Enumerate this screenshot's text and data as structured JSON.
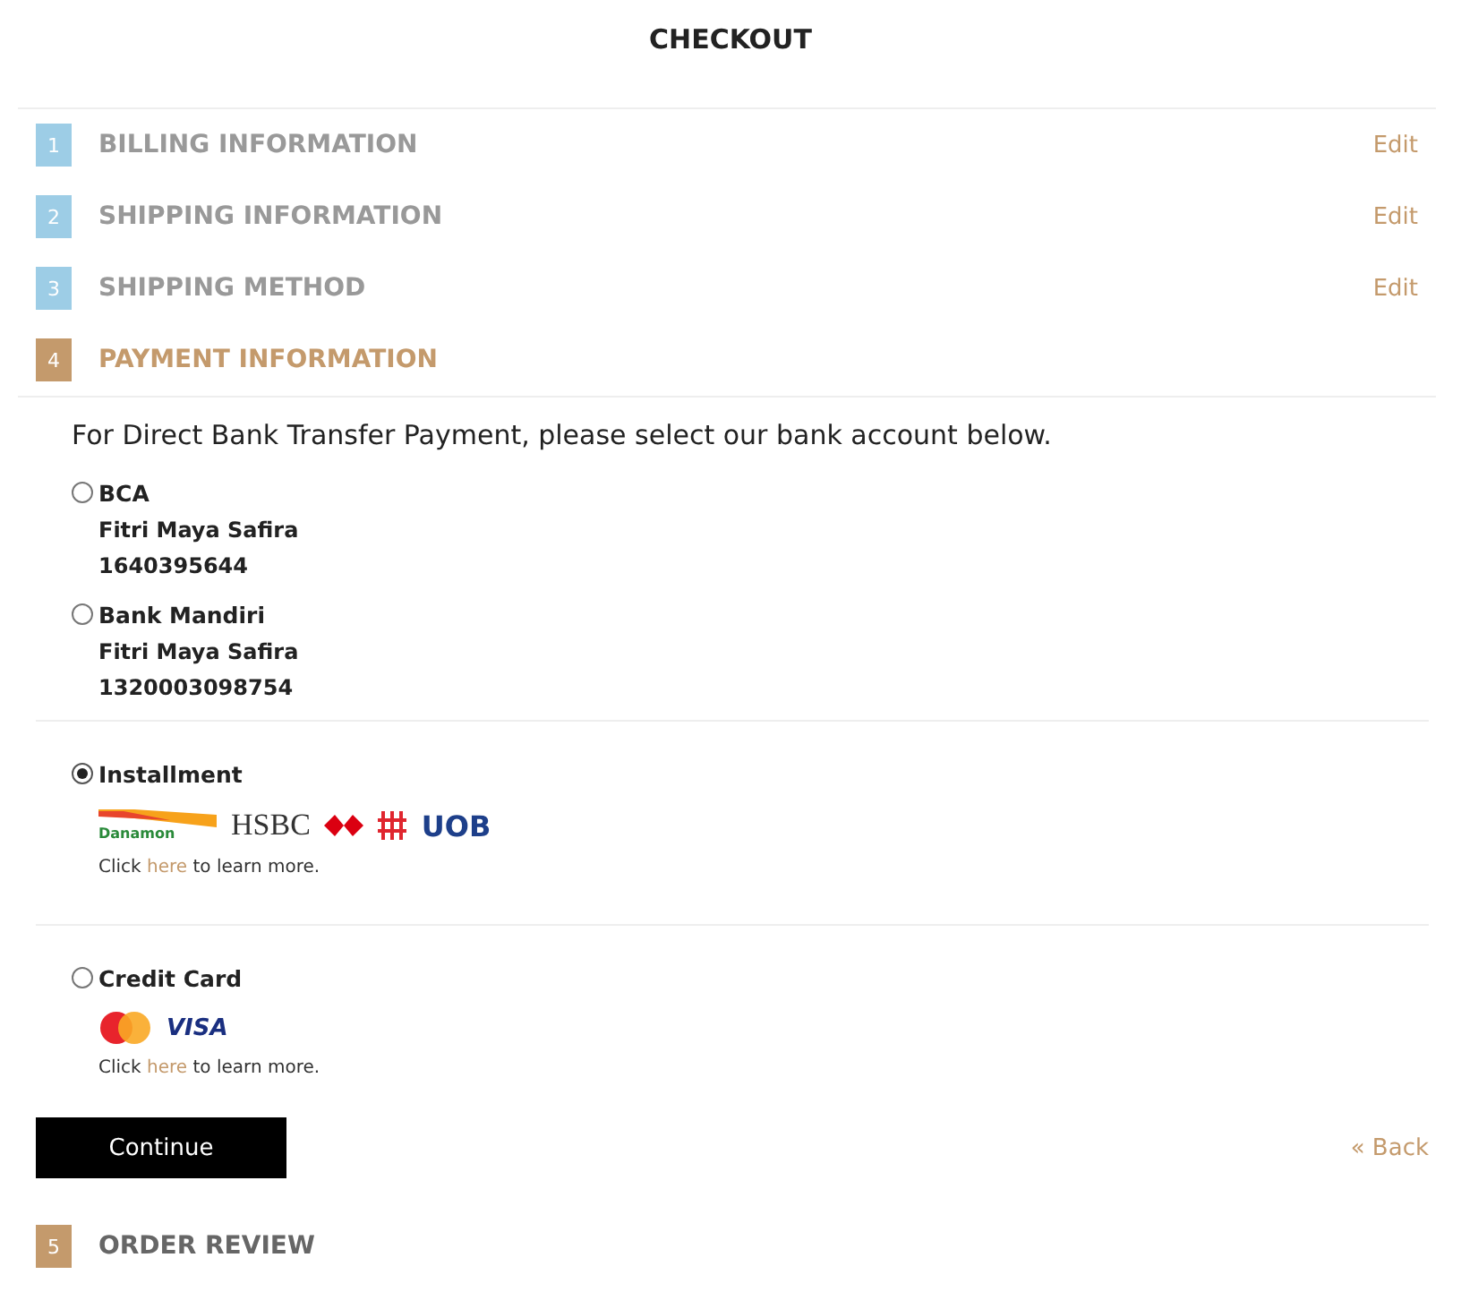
{
  "title": "CHECKOUT",
  "steps": [
    {
      "number": "1",
      "label": "BILLING INFORMATION",
      "kind": "done",
      "action": "Edit"
    },
    {
      "number": "2",
      "label": "SHIPPING INFORMATION",
      "kind": "done",
      "action": "Edit"
    },
    {
      "number": "3",
      "label": "SHIPPING METHOD",
      "kind": "done",
      "action": "Edit"
    },
    {
      "number": "4",
      "label": "PAYMENT INFORMATION",
      "kind": "active"
    }
  ],
  "payment": {
    "intro": "For Direct Bank Transfer Payment, please select our bank account below.",
    "options": [
      {
        "kind": "bank",
        "label": "BCA",
        "selected": false,
        "lines": [
          "Fitri Maya Safira",
          "1640395644"
        ]
      },
      {
        "kind": "bank",
        "label": "Bank Mandiri",
        "selected": false,
        "lines": [
          "Fitri Maya Safira",
          "1320003098754"
        ]
      },
      {
        "kind": "installment",
        "label": "Installment",
        "selected": true,
        "logos": [
          {
            "kind": "danamon",
            "text": "Danamon"
          },
          {
            "kind": "hsbc",
            "text": "HSBC"
          },
          {
            "kind": "uob",
            "text": "UOB"
          }
        ],
        "note": {
          "before": "Click",
          "link": "here",
          "after": "to learn more."
        }
      },
      {
        "kind": "card",
        "label": "Credit Card",
        "selected": false,
        "logos": [
          {
            "kind": "mastercard"
          },
          {
            "kind": "visa",
            "text": "VISA"
          }
        ],
        "note": {
          "before": "Click",
          "link": "here",
          "after": "to learn more."
        }
      }
    ],
    "continue": "Continue",
    "back": "« Back"
  },
  "next_steps": [
    {
      "number": "5",
      "label": "ORDER REVIEW",
      "kind": "pending"
    }
  ]
}
